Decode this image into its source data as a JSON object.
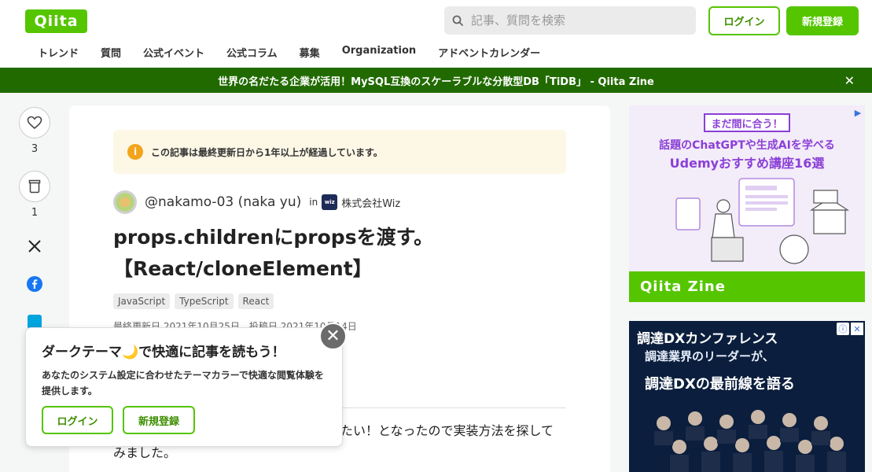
{
  "header": {
    "logo": "Qiita",
    "search_placeholder": "記事、質問を検索",
    "login": "ログイン",
    "signup": "新規登録",
    "nav": [
      "トレンド",
      "質問",
      "公式イベント",
      "公式コラム",
      "募集",
      "Organization",
      "アドベントカレンダー"
    ]
  },
  "banner": {
    "text": "世界の名だたる企業が活用！MySQL互換のスケーラブルな分散型DB「TiDB」 - Qiita Zine",
    "close": "✕"
  },
  "rail": {
    "likes": "3",
    "stocks": "1"
  },
  "article": {
    "notice": "この記事は最終更新日から1年以上が経過しています。",
    "author": "@nakamo-03 (naka yu)",
    "in": "in",
    "org_logo": "wiz",
    "org": "株式会社Wiz",
    "title": "props.childrenにpropsを渡す。【React/cloneElement】",
    "tags": [
      "JavaScript",
      "TypeScript",
      "React"
    ],
    "dates": "最終更新日 2021年10月25日　投稿日 2021年10月14日",
    "body_line1": "たい！となったので実装方法を探して",
    "body_line2": "みました。"
  },
  "popup": {
    "title": "ダークテーマ🌙で快適に記事を読もう！",
    "desc": "あなたのシステム設定に合わせたテーマカラーで快適な閲覧体験を提供します。",
    "login": "ログイン",
    "signup": "新規登録",
    "close": "✕"
  },
  "ad1": {
    "pill": "まだ間に合う！",
    "line1": "話題のChatGPTや生成AIを学べる",
    "line2": "Udemyおすすめ講座16選",
    "footer": "Qiita Zine"
  },
  "ad2": {
    "title": "調達DXカンファレンス",
    "sub1": "調達業界のリーダーが、",
    "sub2": "調達DXの最前線を語る"
  },
  "colors": {
    "brand_green": "#55c500",
    "banner_green": "#216a00",
    "notice_bg": "#fdf7e6"
  }
}
